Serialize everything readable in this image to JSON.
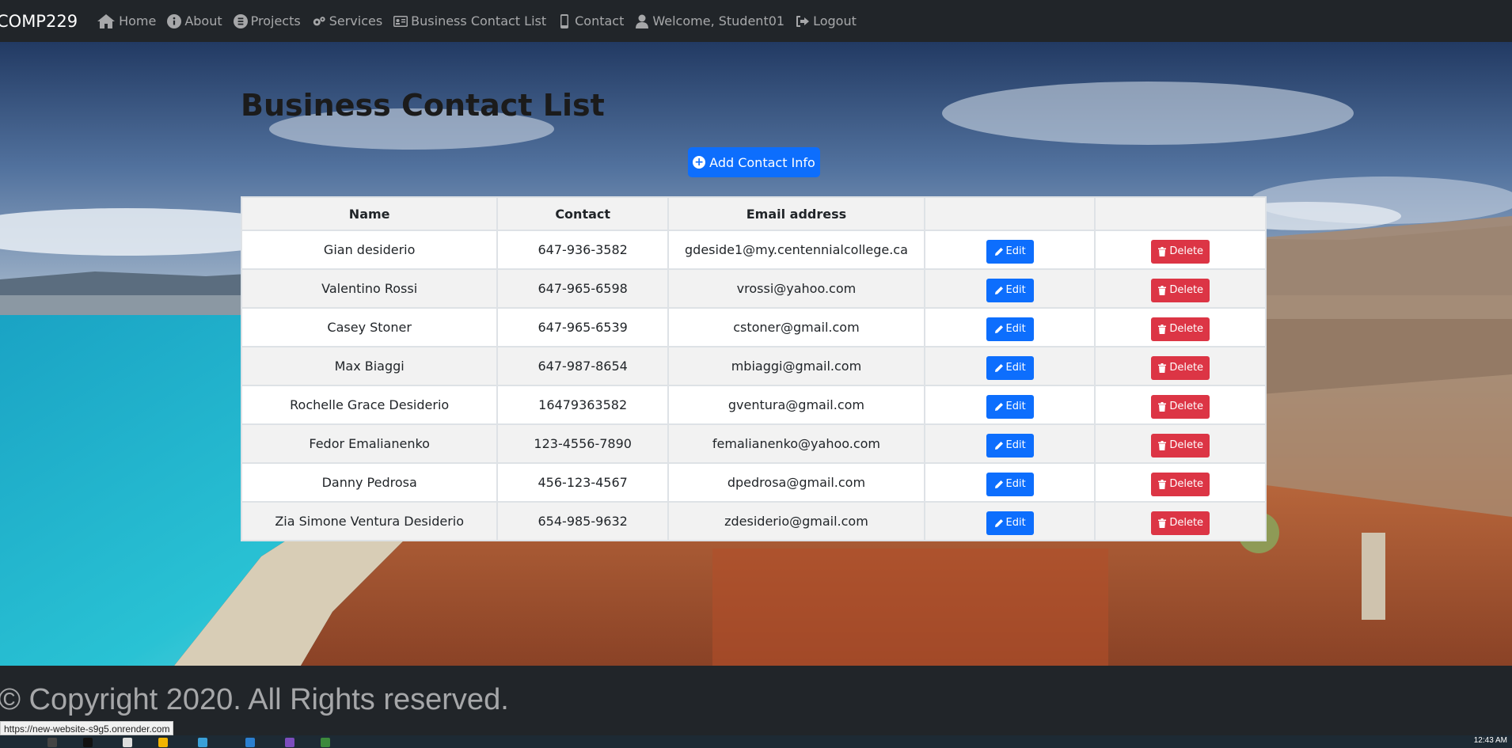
{
  "nav": {
    "brand": "COMP229",
    "items": [
      {
        "label": "Home",
        "icon": "home-icon"
      },
      {
        "label": "About",
        "icon": "info-icon"
      },
      {
        "label": "Projects",
        "icon": "projects-icon"
      },
      {
        "label": "Services",
        "icon": "cogs-icon"
      },
      {
        "label": "Business Contact List",
        "icon": "contact-card-icon"
      },
      {
        "label": "Contact",
        "icon": "mobile-icon"
      },
      {
        "label": "Welcome, Student01",
        "icon": "user-icon"
      },
      {
        "label": "Logout",
        "icon": "logout-icon"
      }
    ]
  },
  "main": {
    "title": "Business Contact List",
    "add_button": "Add Contact Info"
  },
  "table": {
    "headers": [
      "Name",
      "Contact",
      "Email address",
      "",
      ""
    ],
    "edit_label": "Edit",
    "delete_label": "Delete",
    "rows": [
      {
        "name": "Gian desiderio",
        "contact": "647-936-3582",
        "email": "gdeside1@my.centennialcollege.ca"
      },
      {
        "name": "Valentino Rossi",
        "contact": "647-965-6598",
        "email": "vrossi@yahoo.com"
      },
      {
        "name": "Casey Stoner",
        "contact": "647-965-6539",
        "email": "cstoner@gmail.com"
      },
      {
        "name": "Max Biaggi",
        "contact": "647-987-8654",
        "email": "mbiaggi@gmail.com"
      },
      {
        "name": "Rochelle Grace Desiderio",
        "contact": "16479363582",
        "email": "gventura@gmail.com"
      },
      {
        "name": "Fedor Emalianenko",
        "contact": "123-4556-7890",
        "email": "femalianenko@yahoo.com"
      },
      {
        "name": "Danny Pedrosa",
        "contact": "456-123-4567",
        "email": "dpedrosa@gmail.com"
      },
      {
        "name": "Zia Simone Ventura Desiderio",
        "contact": "654-985-9632",
        "email": "zdesiderio@gmail.com"
      }
    ]
  },
  "footer": {
    "copyright": "© Copyright 2020. All Rights reserved."
  },
  "status_bar": {
    "url": "https://new-website-s9g5.onrender.com"
  },
  "taskbar": {
    "clock": "12:43 AM"
  },
  "colors": {
    "primary": "#0d6efd",
    "danger": "#dc3545",
    "dark": "#212529"
  }
}
